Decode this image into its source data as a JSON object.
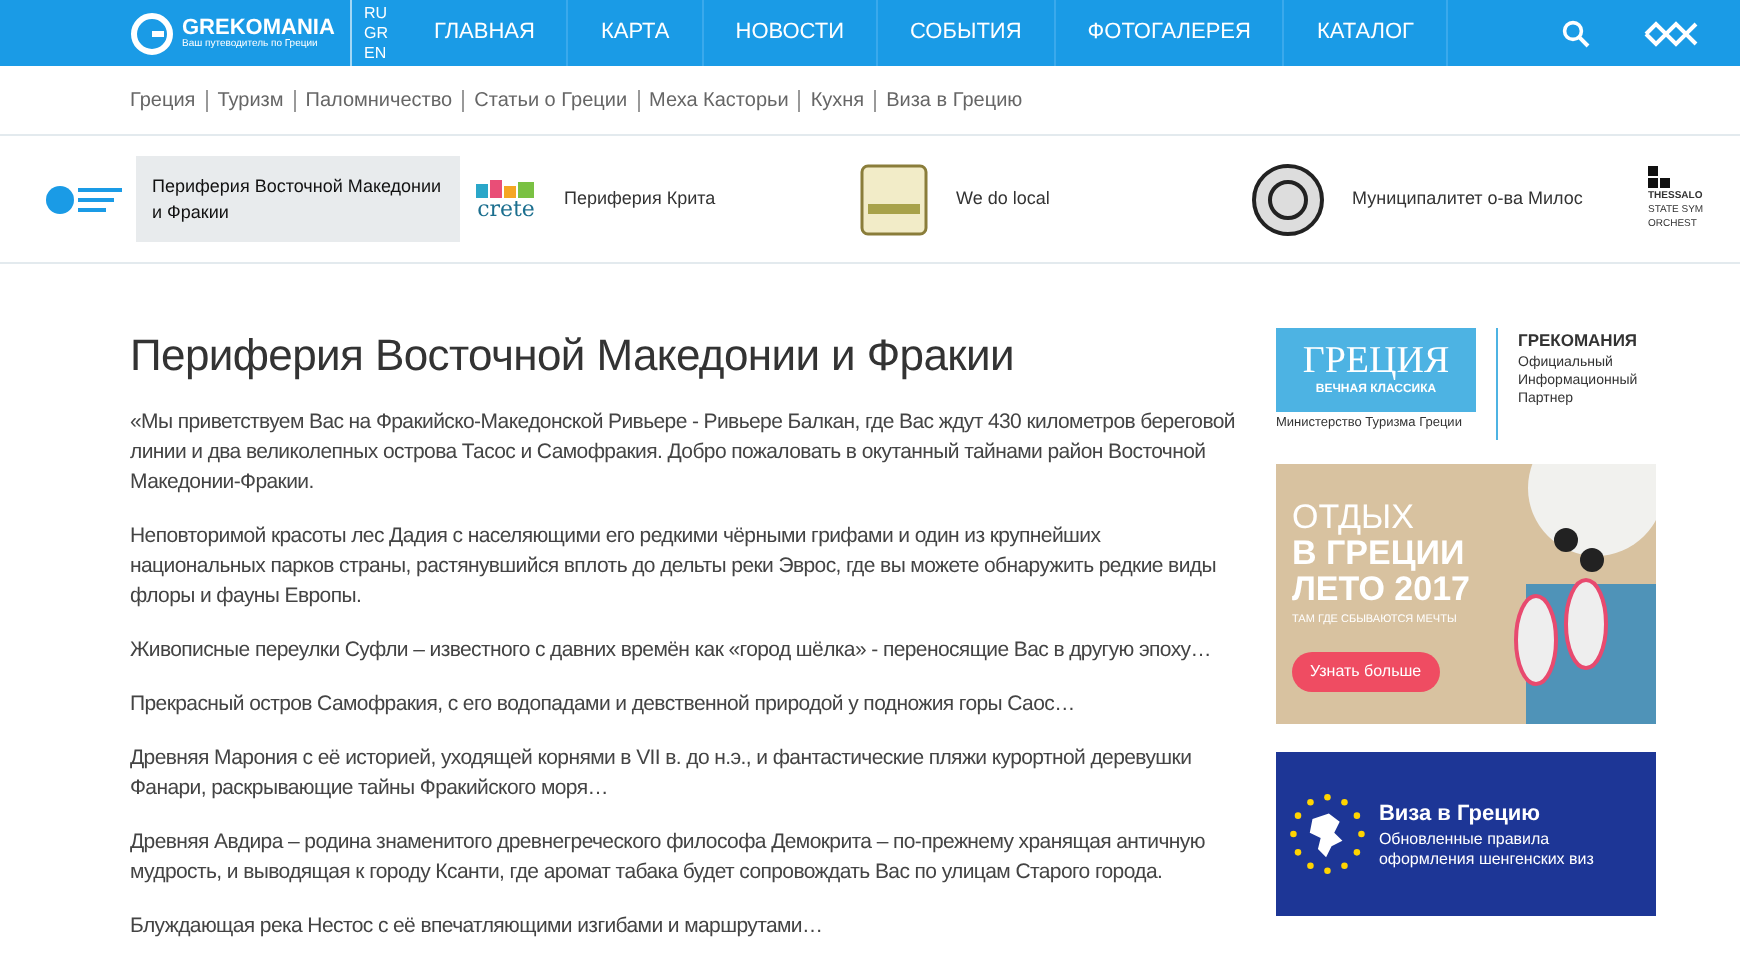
{
  "header": {
    "logo": {
      "name": "GREKOMANIA",
      "tagline": "Ваш путеводитель по Греции"
    },
    "languages": [
      "RU",
      "GR",
      "EN"
    ],
    "nav": [
      "ГЛАВНАЯ",
      "КАРТА",
      "НОВОСТИ",
      "СОБЫТИЯ",
      "ФОТОГАЛЕРЕЯ",
      "КАТАЛОГ"
    ]
  },
  "subnav": [
    "Греция",
    "Туризм",
    "Паломничество",
    "Статьи о Греции",
    "Меха Касторьи",
    "Кухня",
    "Виза в Грецию"
  ],
  "partners": [
    {
      "label": "Периферия Восточной Македонии и Фракии",
      "selected": true,
      "kind": "macedonia"
    },
    {
      "label": "Периферия Крита",
      "selected": false,
      "kind": "crete",
      "logo_text": "crete"
    },
    {
      "label": "We do local",
      "selected": false,
      "kind": "local"
    },
    {
      "label": "Муниципалитет о-ва Милос",
      "selected": false,
      "kind": "coin"
    }
  ],
  "partial_logo": {
    "lines": [
      "THESSALO",
      "STATE SYM",
      "ORCHEST"
    ]
  },
  "article": {
    "title": "Периферия Восточной Македонии и Фракии",
    "paragraphs": [
      "«Мы приветствуем Вас на Фракийско-Македонской  Ривьере - Ривьере Балкан, где Вас ждут 430 километров береговой линии и два великолепных острова Тасос и Самофракия. Добро пожаловать в окутанный тайнами район Восточной Македонии-Фракии.",
      "Неповторимой красоты лес Дадия с населяющими его редкими чёрными грифами и один из крупнейших национальных парков страны, растянувшийся вплоть до дельты реки Эврос, где вы можете обнаружить редкие виды флоры и фауны Европы.",
      "Живописные переулки Суфли –  известного с давних времён как  «город шёлка» -  переносящие Вас в другую эпоху…",
      "Прекрасный остров Самофракия, с его водопадами и девственной природой у подножия горы Саос…",
      "Древняя Марония с её историей, уходящей корнями в VII в. до н.э., и фантастические пляжи курортной деревушки Фанари, раскрывающие тайны Фракийского моря…",
      "Древняя Авдира – родина знаменитого древнегреческого философа Демокрита – по-прежнему хранящая античную мудрость, и выводящая к городу Ксанти, где аромат табака будет сопровождать Вас по улицам Старого города.",
      "Блуждающая река  Нестос с её впечатляющими изгибами и маршрутами…"
    ]
  },
  "sidebar": {
    "ministry_banner": {
      "title": "ГРЕЦИЯ",
      "subtitle": "ВЕЧНАЯ КЛАССИКА",
      "caption": "Министерство Туризма Греции",
      "partner_name": "ГРЕКОМАНИЯ",
      "partner_role": "Официальный Информационный Партнер"
    },
    "summer_banner": {
      "line_1": "ОТДЫХ",
      "line_2": "В ГРЕЦИИ",
      "line_3": "ЛЕТО 2017",
      "slogan": "ТАМ ГДЕ СБЫВАЮТСЯ МЕЧТЫ",
      "button": "Узнать больше"
    },
    "visa_banner": {
      "title": "Виза в Грецию",
      "text": "Обновленные правила оформления шенгенских виз"
    }
  }
}
